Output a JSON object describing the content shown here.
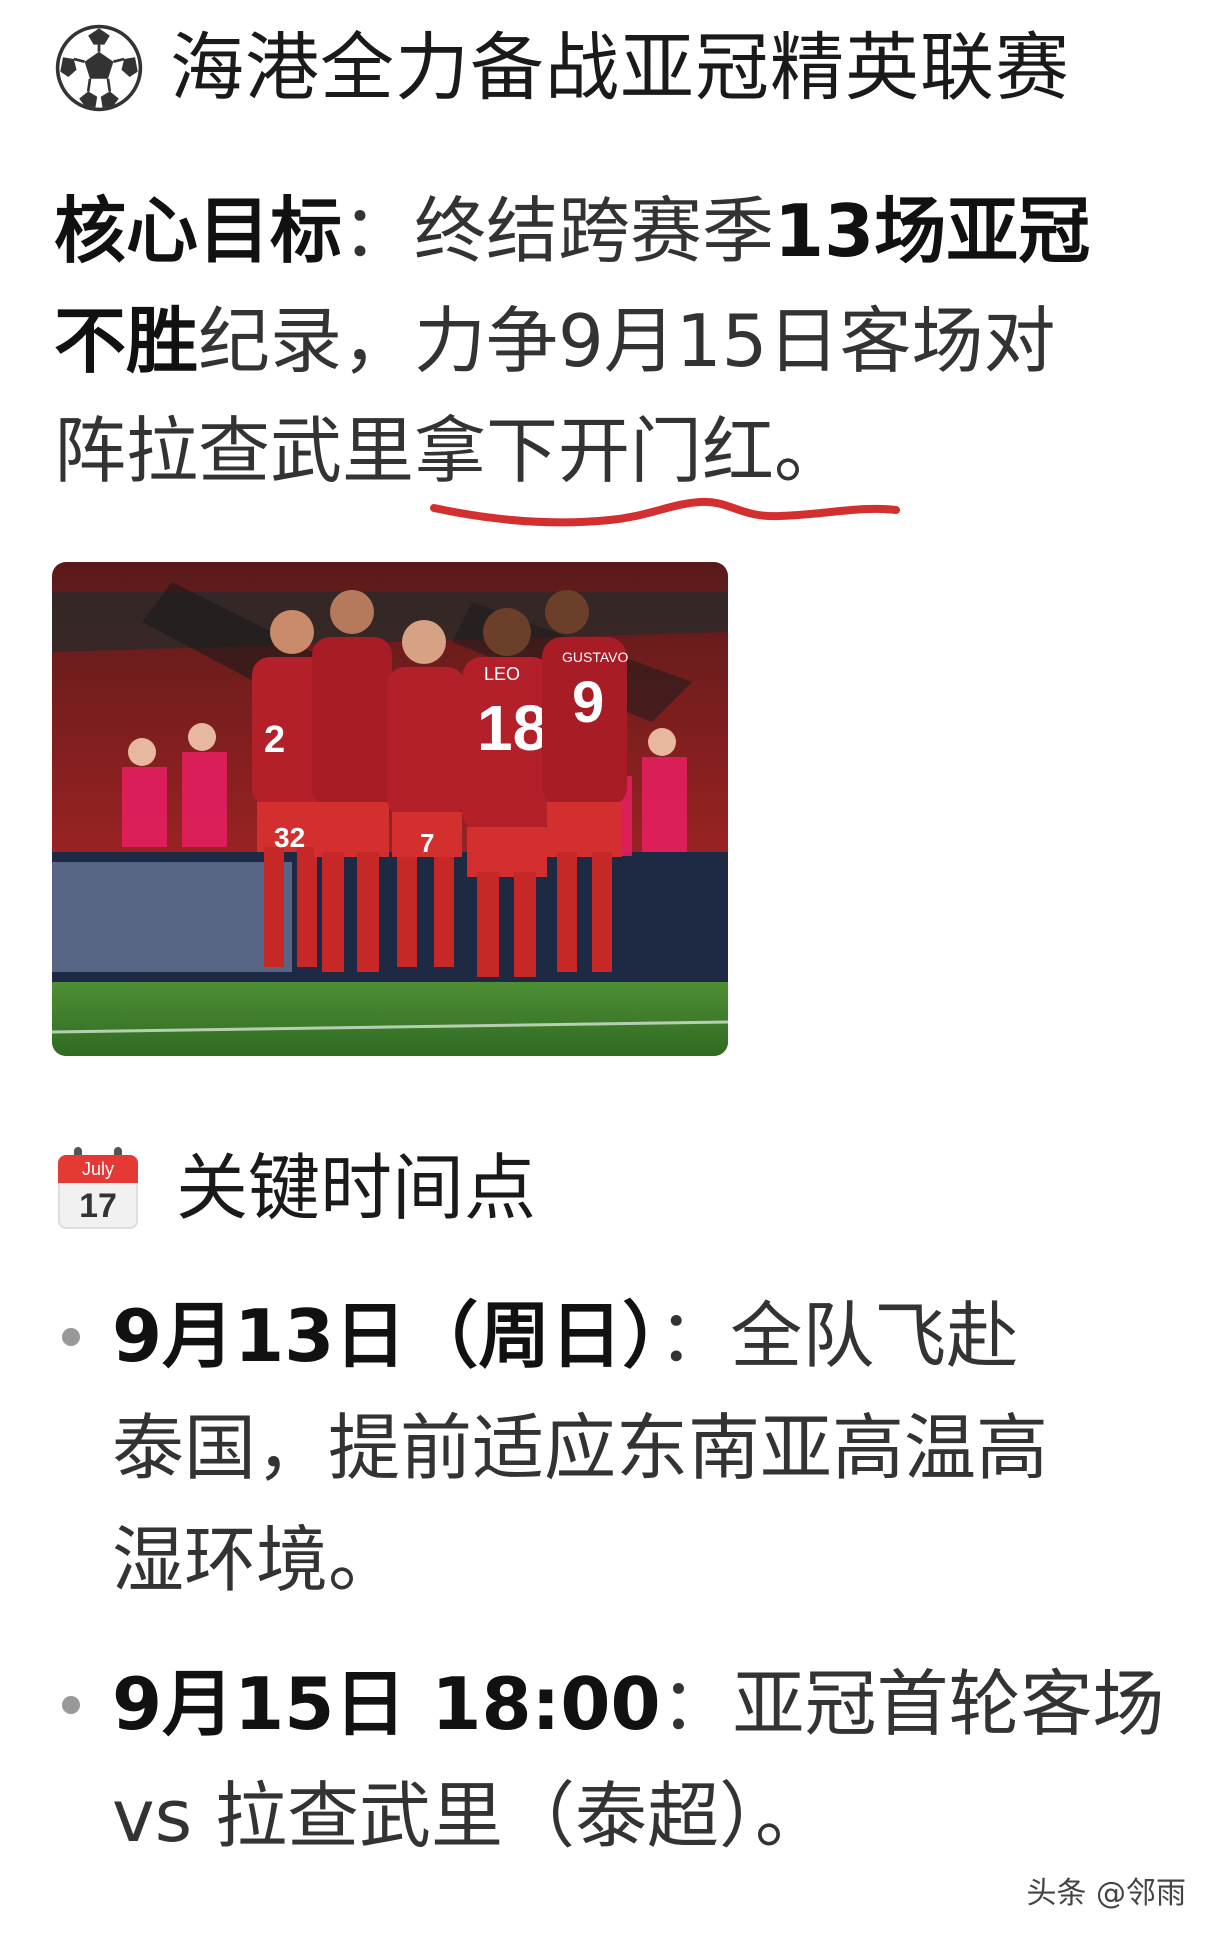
{
  "title": {
    "icon": "soccer-ball-icon",
    "text": "海港全力备战亚冠精英联赛"
  },
  "goal": {
    "line1_label": "核心目标",
    "line1_colon": "：",
    "line1_mid": "终结跨赛季",
    "line1_bold": "13场亚冠",
    "line2_bold": "不胜",
    "line2_rest": "纪录，力争9月15日客场对",
    "line3_start": "阵拉查武里",
    "line3_underlined": "拿下开门红",
    "line3_end": "。",
    "underline_color": "#d32f2f"
  },
  "photo": {
    "jersey_numbers": [
      "2",
      "32",
      "18",
      "9",
      "7"
    ],
    "jersey_names": [
      "LEO",
      "GUSTAVO"
    ]
  },
  "section": {
    "icon": "calendar-icon",
    "calendar_month": "July",
    "calendar_day": "17",
    "title": "关键时间点"
  },
  "timeline": [
    {
      "date": "9月13日（周日）",
      "lines": [
        "：全队飞赴",
        "泰国，提前适应东南亚高温高",
        "湿环境。"
      ]
    },
    {
      "date": "9月15日 18:00",
      "lines": [
        "：亚冠首轮客场",
        "vs 拉查武里（泰超）。"
      ]
    }
  ],
  "watermark": "头条 @邻雨",
  "colors": {
    "accent_red": "#d32f2f",
    "jersey_red": "#b3202a",
    "pitch_green": "#3f7d2c"
  }
}
